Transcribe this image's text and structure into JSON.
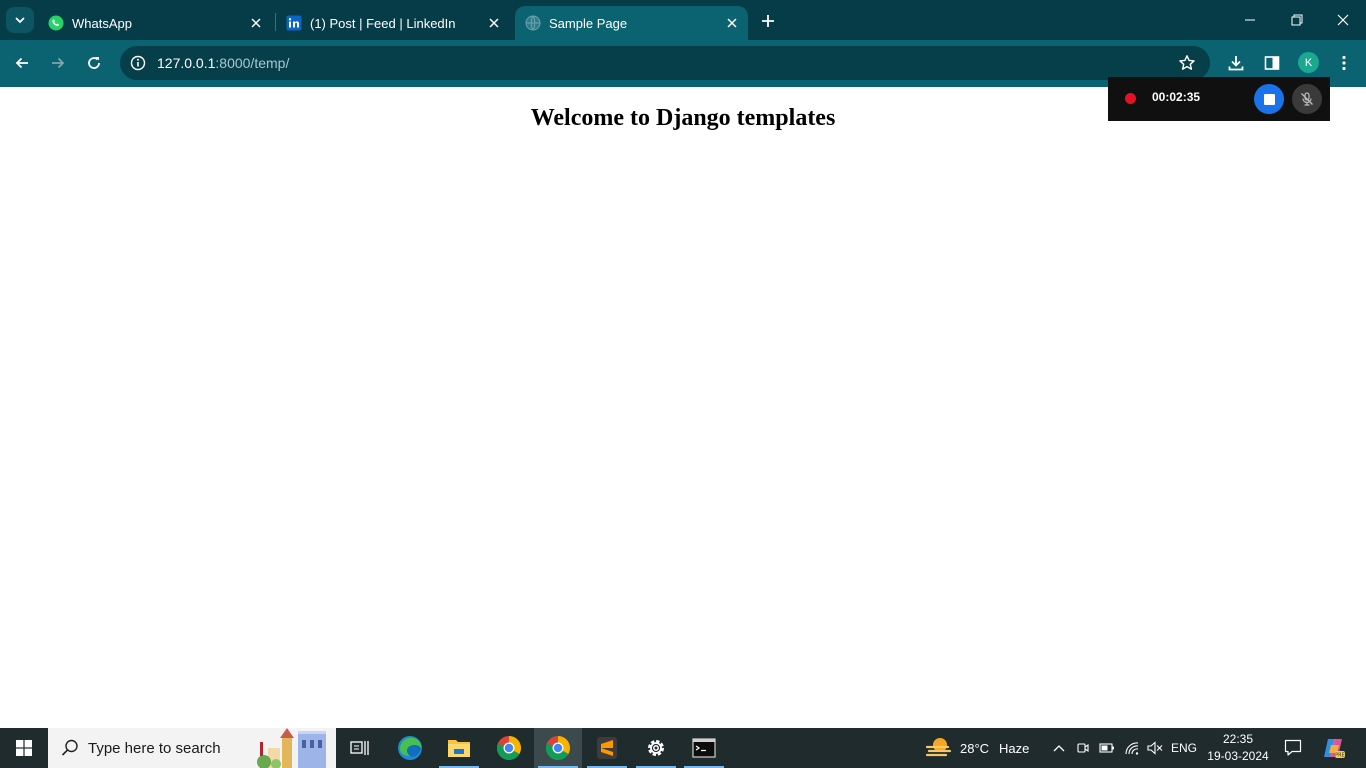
{
  "browser": {
    "tabs": [
      {
        "title": "WhatsApp",
        "favicon": "whatsapp-icon",
        "active": false
      },
      {
        "title": "(1) Post | Feed | LinkedIn",
        "favicon": "linkedin-icon",
        "active": false
      },
      {
        "title": "Sample Page",
        "favicon": "globe-icon",
        "active": true
      }
    ],
    "address": {
      "host": "127.0.0.1",
      "path": ":8000/temp/"
    },
    "profile_initial": "K",
    "colors": {
      "tabstrip": "#063b48",
      "toolbar": "#0b6270",
      "omnibox": "#063f4a"
    }
  },
  "page": {
    "heading": "Welcome to Django templates"
  },
  "recorder": {
    "elapsed": "00:02:35"
  },
  "taskbar": {
    "search_placeholder": "Type here to search",
    "apps": [
      "task-view-icon",
      "edge-icon",
      "file-explorer-icon",
      "chrome-icon",
      "chrome-icon",
      "sublime-text-icon",
      "settings-icon",
      "terminal-icon"
    ],
    "weather": {
      "temperature": "28°C",
      "condition": "Haze"
    },
    "language": "ENG",
    "time": "22:35",
    "date": "19-03-2024"
  }
}
